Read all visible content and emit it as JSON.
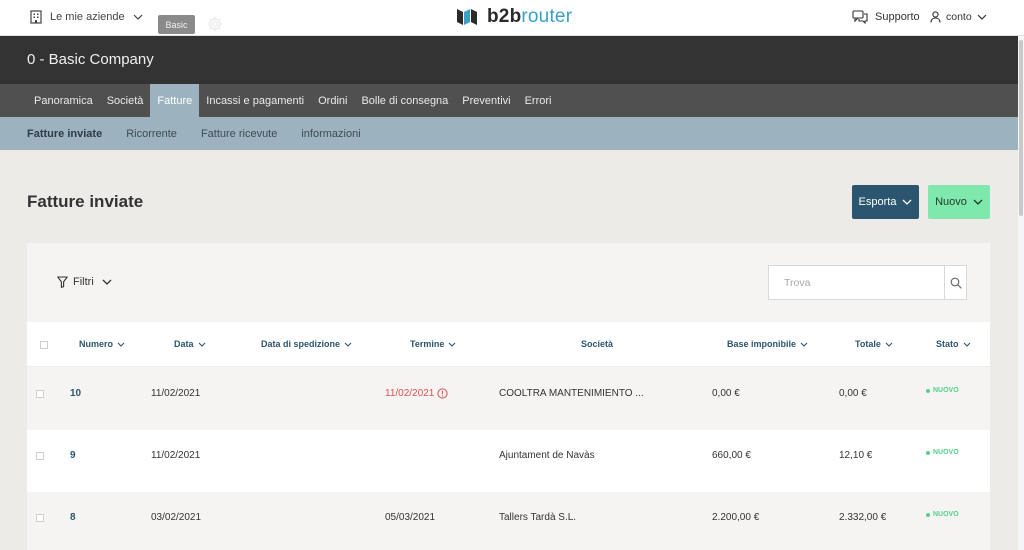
{
  "topbar": {
    "companies_label": "Le mie aziende",
    "logo_text_a": "b2b",
    "logo_text_b": "router",
    "support_label": "Supporto",
    "account_label": "conto"
  },
  "company": {
    "name": "0 - Basic Company",
    "plan": "Basic"
  },
  "mainnav": [
    {
      "label": "Panoramica",
      "active": false
    },
    {
      "label": "Società",
      "active": false
    },
    {
      "label": "Fatture",
      "active": true
    },
    {
      "label": "Incassi e pagamenti",
      "active": false
    },
    {
      "label": "Ordini",
      "active": false
    },
    {
      "label": "Bolle di consegna",
      "active": false
    },
    {
      "label": "Preventivi",
      "active": false
    },
    {
      "label": "Errori",
      "active": false
    }
  ],
  "subnav": [
    {
      "label": "Fatture inviate",
      "active": true
    },
    {
      "label": "Ricorrente",
      "active": false
    },
    {
      "label": "Fatture ricevute",
      "active": false
    },
    {
      "label": "informazioni",
      "active": false
    }
  ],
  "page": {
    "title": "Fatture inviate",
    "export_label": "Esporta",
    "new_label": "Nuovo",
    "filters_label": "Filtri",
    "search_placeholder": "Trova"
  },
  "table": {
    "columns": [
      "Numero",
      "Data",
      "Data di spedizione",
      "Termine",
      "Società",
      "Base imponibile",
      "Totale",
      "Stato"
    ],
    "rows": [
      {
        "numero": "10",
        "data": "11/02/2021",
        "spedizione": "",
        "termine": "11/02/2021",
        "termine_late": true,
        "societa": "COOLTRA MANTENIMIENTO ...",
        "base": "0,00 €",
        "totale": "0,00 €",
        "stato": "NUOVO"
      },
      {
        "numero": "9",
        "data": "11/02/2021",
        "spedizione": "",
        "termine": "",
        "termine_late": false,
        "societa": "Ajuntament de Navàs",
        "base": "660,00 €",
        "totale": "12,10 €",
        "stato": "NUOVO"
      },
      {
        "numero": "8",
        "data": "03/02/2021",
        "spedizione": "",
        "termine": "05/03/2021",
        "termine_late": false,
        "societa": "Tallers Tardà S.L.",
        "base": "2.200,00 €",
        "totale": "2.332,00 €",
        "stato": "NUOVO"
      }
    ]
  },
  "colors": {
    "primary": "#2c5670",
    "new_button": "#7ee8ad",
    "status_new": "#55d08a",
    "late": "#d9534f",
    "subnav": "#9cb3bf"
  }
}
